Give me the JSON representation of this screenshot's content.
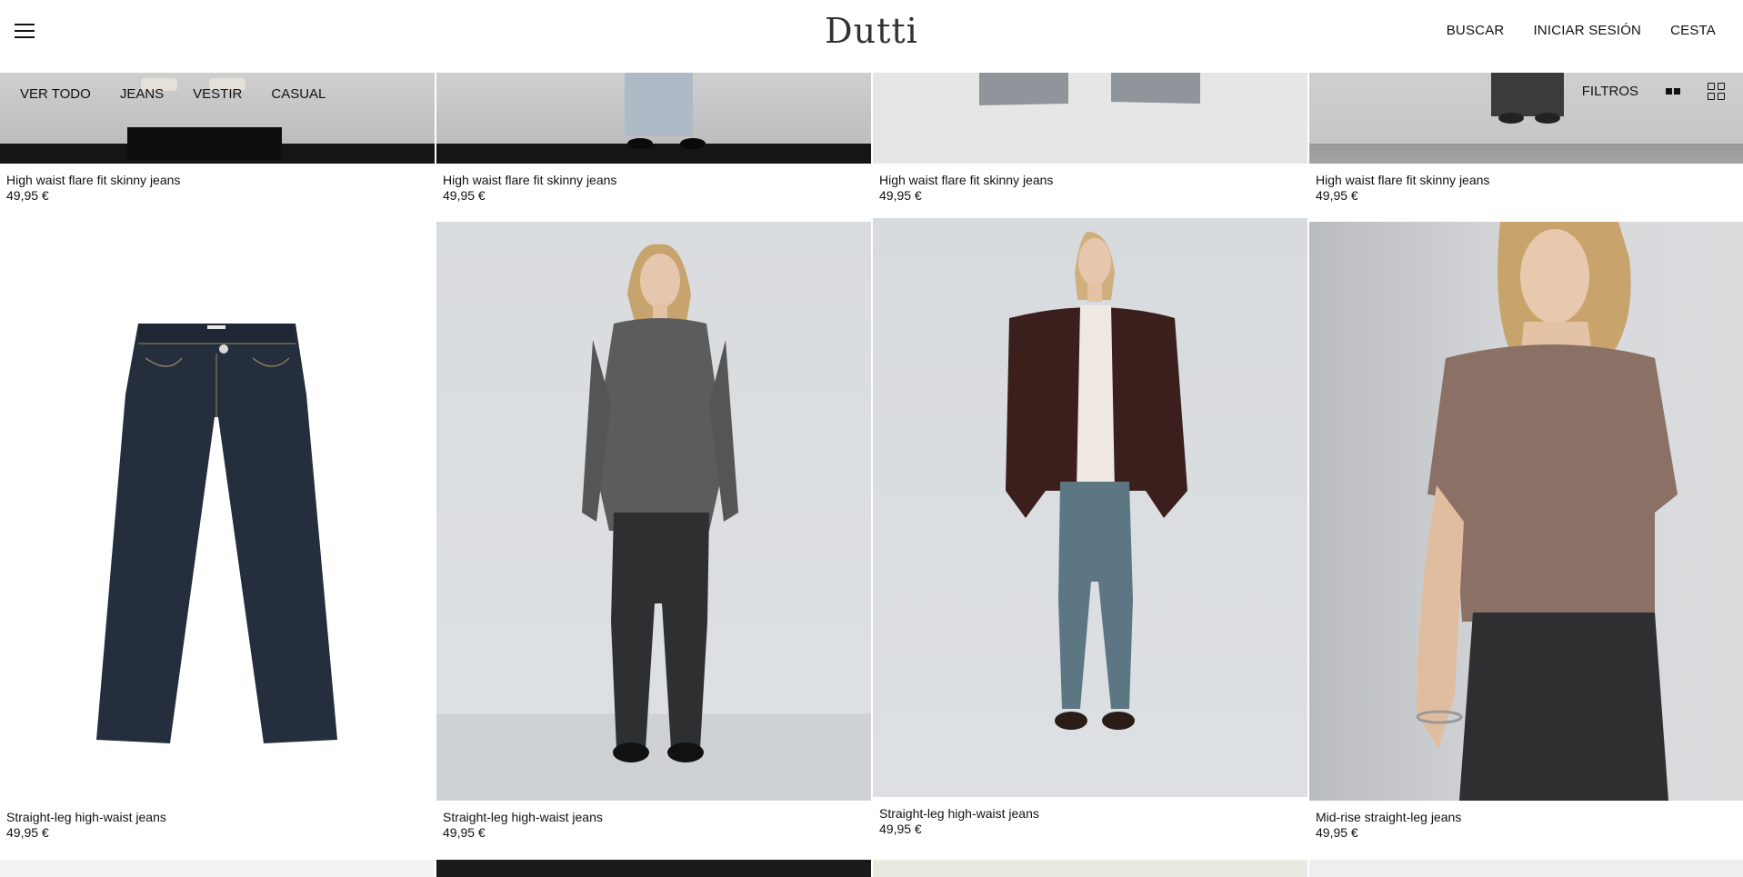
{
  "header": {
    "logo": "Dutti",
    "links": {
      "search": "BUSCAR",
      "login": "INICIAR SESIÓN",
      "cart": "CESTA"
    }
  },
  "filterbar": {
    "categories": [
      "VER TODO",
      "JEANS",
      "VESTIR",
      "CASUAL"
    ],
    "filters_label": "FILTROS"
  },
  "products": [
    {
      "name": "High waist flare fit skinny jeans",
      "price": "49,95 €"
    },
    {
      "name": "High waist flare fit skinny jeans",
      "price": "49,95 €"
    },
    {
      "name": "High waist flare fit skinny jeans",
      "price": "49,95 €"
    },
    {
      "name": "High waist flare fit skinny jeans",
      "price": "49,95 €"
    },
    {
      "name": "Straight-leg high-waist jeans",
      "price": "49,95 €"
    },
    {
      "name": "Straight-leg high-waist jeans",
      "price": "49,95 €"
    },
    {
      "name": "Straight-leg high-waist jeans",
      "price": "49,95 €"
    },
    {
      "name": "Mid-rise straight-leg jeans",
      "price": "49,95 €"
    }
  ],
  "colors": {
    "denim_dark": "#252e3d",
    "denim_black": "#2e2f31",
    "denim_blue": "#5d7684",
    "suede": "#3a1f1c",
    "tee": "#8a7065"
  }
}
